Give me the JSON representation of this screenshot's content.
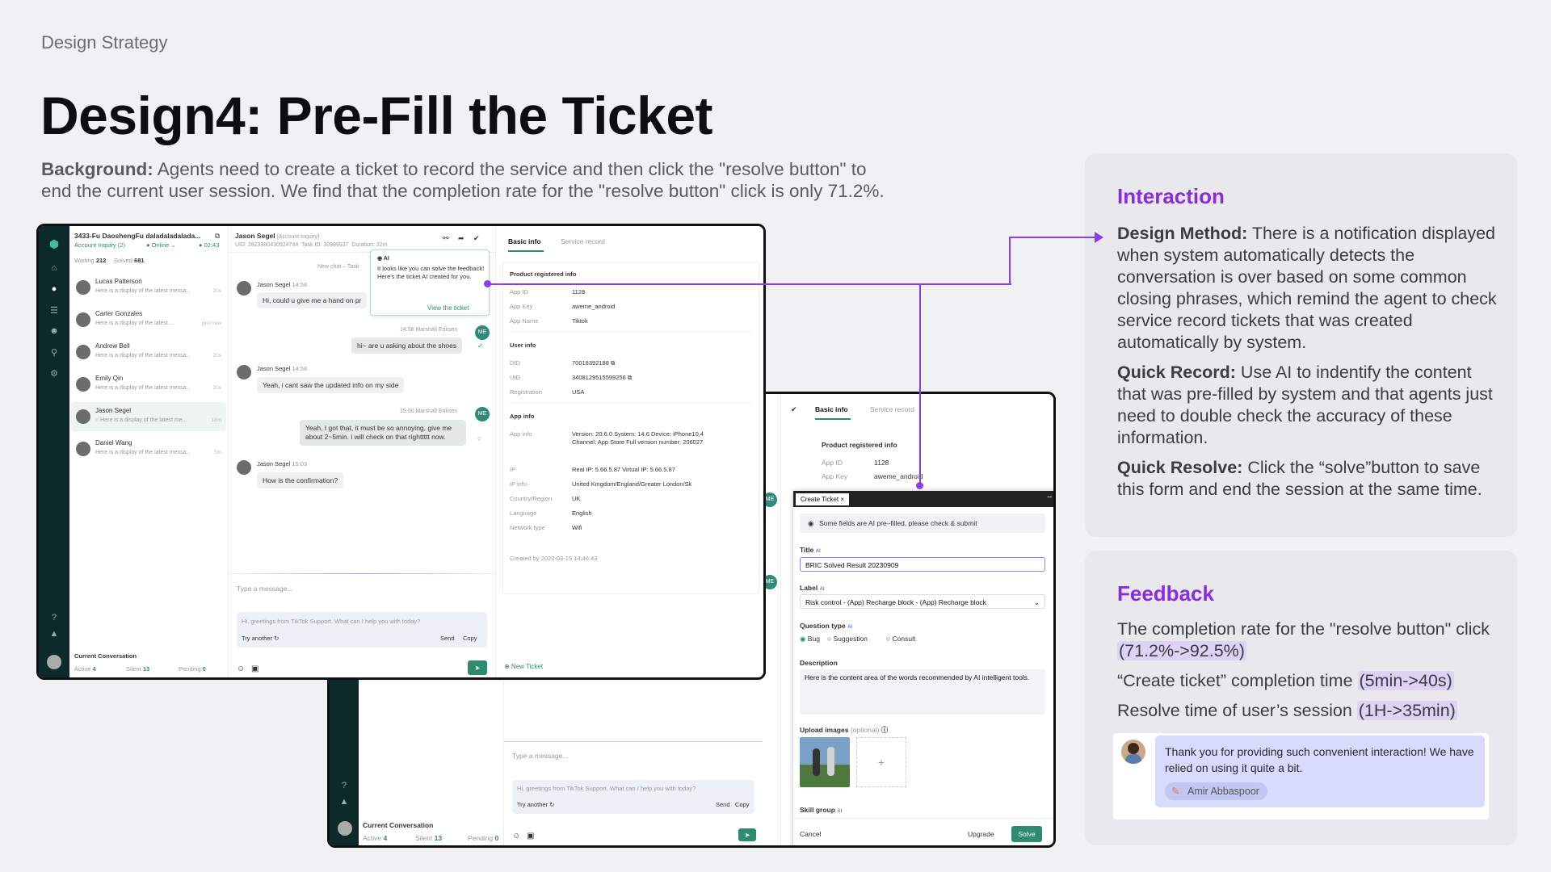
{
  "eyebrow": "Design Strategy",
  "title": "Design4: Pre-Fill the Ticket",
  "background": {
    "label": "Background:",
    "text1": " Agents need to create a ticket to record the service and then click the \"resolve button\" to end the current user session.",
    "text2": " We find that the completion rate for the \"resolve button\" click is only 71.2%."
  },
  "interaction": {
    "heading": "Interaction",
    "items": [
      {
        "label": "Design Method:",
        "text": " There is a notification displayed when system automatically detects the conversation is over based on some common closing phrases, which remind the agent to check service record tickets that was created automatically by system."
      },
      {
        "label": "Quick Record:",
        "text": " Use AI to indentify the content that was pre-filled by system and that agents just need to double check the accuracy of these information."
      },
      {
        "label": "Quick Resolve:",
        "text": " Click the “solve”button to save this form and end the session at the same time."
      }
    ]
  },
  "feedback": {
    "heading": "Feedback",
    "items": [
      {
        "text": "The completion rate for the \"resolve button\" click ",
        "hl": "(71.2%->92.5%)"
      },
      {
        "text": "“Create ticket” completion time ",
        "hl": "(5min->40s)"
      },
      {
        "text": "Resolve time of user’s session ",
        "hl": "(1H->35min)"
      }
    ],
    "quote": "Thank you for providing such convenient interaction! We have relied on using it quite a bit.",
    "author": "Amir Abbaspoor"
  },
  "app1": {
    "session_title": "3433-Fu DaoshengFu daladaladalada...",
    "session_sub": "Account Inquiry  (2)",
    "status": "● Online ⌄",
    "timer": "● 02:43",
    "waiting": "Waiting",
    "waiting_n": "212",
    "solved": "Solved",
    "solved_n": "681",
    "contacts": [
      {
        "name": "Lucas Patterson",
        "msg": "Here is a display of the latest messa...",
        "t": "20s"
      },
      {
        "name": "Carter Gonzales",
        "msg": "Here is a display of the latest ...",
        "t": "just now"
      },
      {
        "name": "Andrew Bell",
        "msg": "Here is a display of the latest messa...",
        "t": "20s"
      },
      {
        "name": "Emily Qin",
        "msg": "Here is a display of the latest messa...",
        "t": "20s"
      },
      {
        "name": "Jason Segel",
        "msg": "○ Here is a display of the latest me...",
        "t": "18m"
      },
      {
        "name": "Daniel Wang",
        "msg": "Here is a display of the latest messa...",
        "t": "5m"
      }
    ],
    "current_conv": "Current Conversation",
    "active": "Active",
    "active_n": "4",
    "silent": "Silent",
    "silent_n": "13",
    "pending": "Pending",
    "pending_n": "0",
    "chat_user": "Jason Segel",
    "chat_tag": "[Account Inquiry]",
    "chat_uid": "UID: 2823980430924744",
    "task": "Task ID: 30989537",
    "duration": "Duration: 32m",
    "new_chat": "New chat – Task",
    "m1_name": "Jason Segel",
    "m1_time": "14:58",
    "m1": "Hi, could u give me a hand on pr",
    "m2_meta": "14:58  Marshall Eriksen",
    "m2": "hi~ are u asking about the shoes",
    "m3_name": "Jason Segel",
    "m3_time": "14:58",
    "m3": "Yeah, i cant saw the updated info on my side",
    "m4_meta": "15:00  Marshall Eriksen",
    "m4": "Yeah, I got that, it must be so annoying, give me about 2~5min. i will check on that righttttt now.",
    "m5_name": "Jason Segel",
    "m5_time": "15:03",
    "m5": "How is the confirmation?",
    "me": "ME",
    "ai_tag": "AI",
    "ai_text": "It looks like you can solve the feedback! Here's the ticket AI created for you.",
    "ai_link": "View the ticket",
    "type_ph": "Type a message...",
    "suggest": "Hi, greetings from TikTok Support. What can I help you with today?",
    "try": "Try another ↻",
    "send": "Send",
    "copy": "Copy",
    "tab_basic": "Basic info",
    "tab_service": "Service record",
    "prod_head": "Product registered info",
    "app_id_k": "App ID",
    "app_id_v": "1128",
    "app_key_k": "App Key",
    "app_key_v": "aweme_android",
    "app_name_k": "App Name",
    "app_name_v": "Tiktok",
    "user_head": "User info",
    "did_k": "DID",
    "did_v": "70018392188 ⧉",
    "uid_k": "UID",
    "uid_v": "3408129515599256 ⧉",
    "reg_k": "Registration",
    "reg_v": "USA",
    "appinfo_head": "App info",
    "ai_k": "App info",
    "ai_v": "Version: 20.6.0 System: 14.6 Device: iPhone10,4 Channel: App Store Full version number: 206027",
    "ip_k": "IP",
    "ip_v": "Real IP: 5.66.5.87 Virtual IP: 5.66.5.87",
    "ipinfo_k": "IP info",
    "ipinfo_v": "United Kingdom/England/Greater London/Sk",
    "country_k": "Country/Region",
    "country_v": "UK",
    "lang_k": "Language",
    "lang_v": "English",
    "net_k": "Network type",
    "net_v": "Wifi",
    "created": "Created by 2020-03-15 14:46:43",
    "new_ticket": "⊕ New Ticket"
  },
  "app2": {
    "tab_basic": "Basic info",
    "tab_service": "Service record",
    "prod_head": "Product registered info",
    "app_id_k": "App ID",
    "app_id_v": "1128",
    "app_key_k": "App Key",
    "app_key_v": "aweme_android",
    "create_tab": "Create Ticket  ×",
    "notice": "Some fields are AI pre–filled, please check & submit",
    "title_lbl": "Title",
    "title_val": "BRIC Solved Result 20230909",
    "label_lbl": "Label",
    "label_val": "Risk control - (App) Recharge block - (App) Recharge block",
    "qtype_lbl": "Question type",
    "q_bug": "Bug",
    "q_sugg": "Suggestion",
    "q_consult": "Consult",
    "desc_lbl": "Description",
    "desc_val": "Here is the content area of the words recommended by AI intelligent tools.",
    "upload_lbl": "Upload images",
    "upload_opt": "(optional)",
    "skill_lbl": "Skill group",
    "ai": "AI",
    "cancel": "Cancel",
    "upgrade": "Upgrade",
    "solve": "Solve",
    "type_ph": "Type a message...",
    "suggest": "Hi, greetings from TikTok Support. What can I help you with today?",
    "try": "Try another ↻",
    "send": "Send",
    "copy": "Copy",
    "current_conv": "Current Conversation",
    "active": "Active",
    "active_n": "4",
    "silent": "Silent",
    "silent_n": "13",
    "pending": "Pending",
    "pending_n": "0",
    "me": "ME"
  },
  "colors": {
    "accent": "#8a2be2",
    "brand": "#2e8b6e",
    "rail": "#0d2a2a"
  }
}
